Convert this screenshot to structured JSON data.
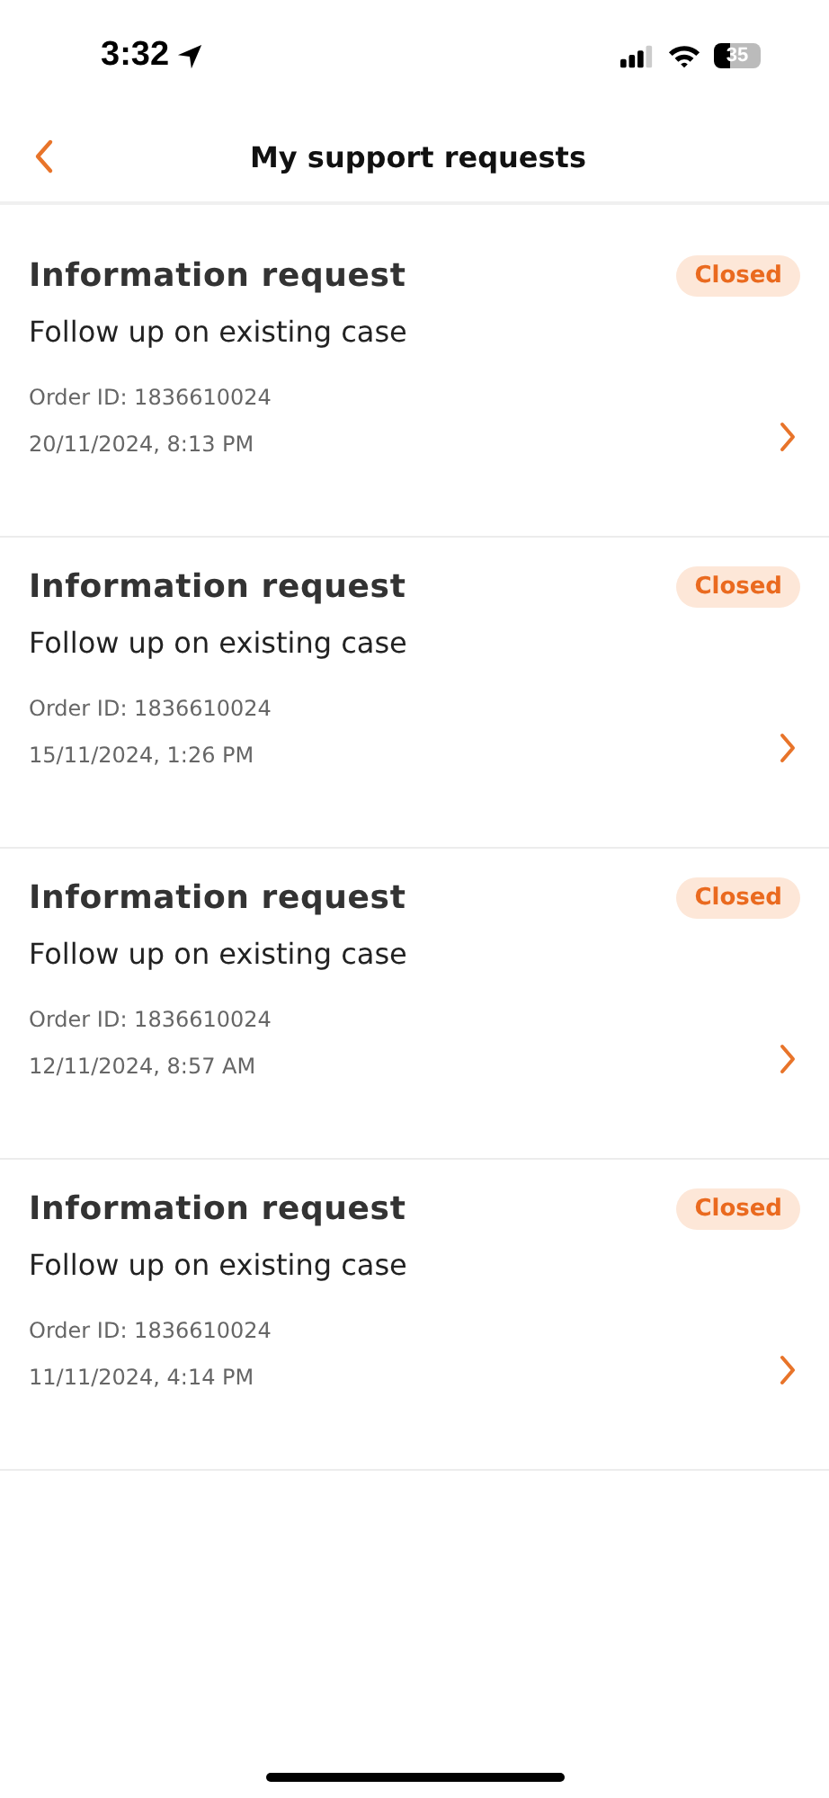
{
  "status_bar": {
    "time": "3:32",
    "battery": "35"
  },
  "header": {
    "title": "My support requests"
  },
  "requests": [
    {
      "title": "Information request",
      "status": "Closed",
      "subtitle": "Follow up on existing case",
      "order_id": "Order ID: 1836610024",
      "date": "20/11/2024, 8:13 PM"
    },
    {
      "title": "Information request",
      "status": "Closed",
      "subtitle": "Follow up on existing case",
      "order_id": "Order ID: 1836610024",
      "date": "15/11/2024, 1:26 PM"
    },
    {
      "title": "Information request",
      "status": "Closed",
      "subtitle": "Follow up on existing case",
      "order_id": "Order ID: 1836610024",
      "date": "12/11/2024, 8:57 AM"
    },
    {
      "title": "Information request",
      "status": "Closed",
      "subtitle": "Follow up on existing case",
      "order_id": "Order ID: 1836610024",
      "date": "11/11/2024, 4:14 PM"
    }
  ]
}
